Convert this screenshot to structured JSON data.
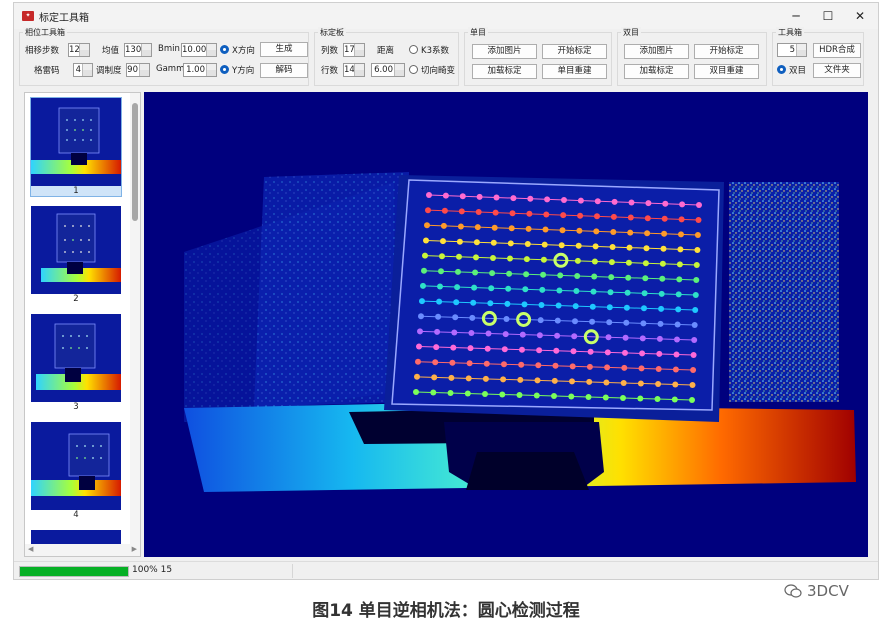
{
  "window": {
    "title": "标定工具箱",
    "controls": {
      "minimize": "─",
      "maximize": "☐",
      "close": "✕"
    }
  },
  "phase_toolbox": {
    "title": "相位工具箱",
    "shift_steps_label": "相移步数",
    "shift_steps": "12",
    "mean_label": "均值",
    "mean": "130",
    "bmin_label": "Bmin",
    "bmin": "10.00",
    "x_dir_label": "X方向",
    "generate_label": "生成",
    "gray_code_label": "格雷码",
    "gray_code": "4",
    "modulation_label": "调制度",
    "modulation": "90",
    "gamma_label": "Gamma",
    "gamma": "1.00",
    "y_dir_label": "Y方向",
    "decode_label": "解码"
  },
  "board": {
    "title": "标定板",
    "cols_label": "列数",
    "cols": "17",
    "distance_label": "距离",
    "k3_label": "K3系数",
    "rows_label": "行数",
    "rows": "14",
    "distance": "6.00",
    "tangential_label": "切向畸变"
  },
  "mono": {
    "title": "单目",
    "add_image": "添加图片",
    "start_calib": "开始标定",
    "load_calib": "加载标定",
    "mono_reconstruct": "单目重建"
  },
  "stereo": {
    "title": "双目",
    "add_image": "添加图片",
    "start_calib": "开始标定",
    "load_calib": "加载标定",
    "stereo_reconstruct": "双目重建"
  },
  "tools": {
    "title": "工具箱",
    "hdr_count": "5",
    "hdr_label": "HDR合成",
    "stereo_label": "双目",
    "folder_label": "文件夹"
  },
  "thumbnails": [
    {
      "label": "1"
    },
    {
      "label": "2"
    },
    {
      "label": "3"
    },
    {
      "label": "4"
    }
  ],
  "status": {
    "progress": 1.0,
    "progress_text": "100%",
    "count": "15"
  },
  "caption": "图14 单目逆相机法：圆心检测过程",
  "watermark": "3DCV",
  "icons": {
    "app": "calibration-app-icon",
    "watermark": "wechat-icon"
  },
  "colors": {
    "viewer_bg": "#00007e",
    "progress": "#06b025",
    "radio": "#0f5fbf"
  }
}
